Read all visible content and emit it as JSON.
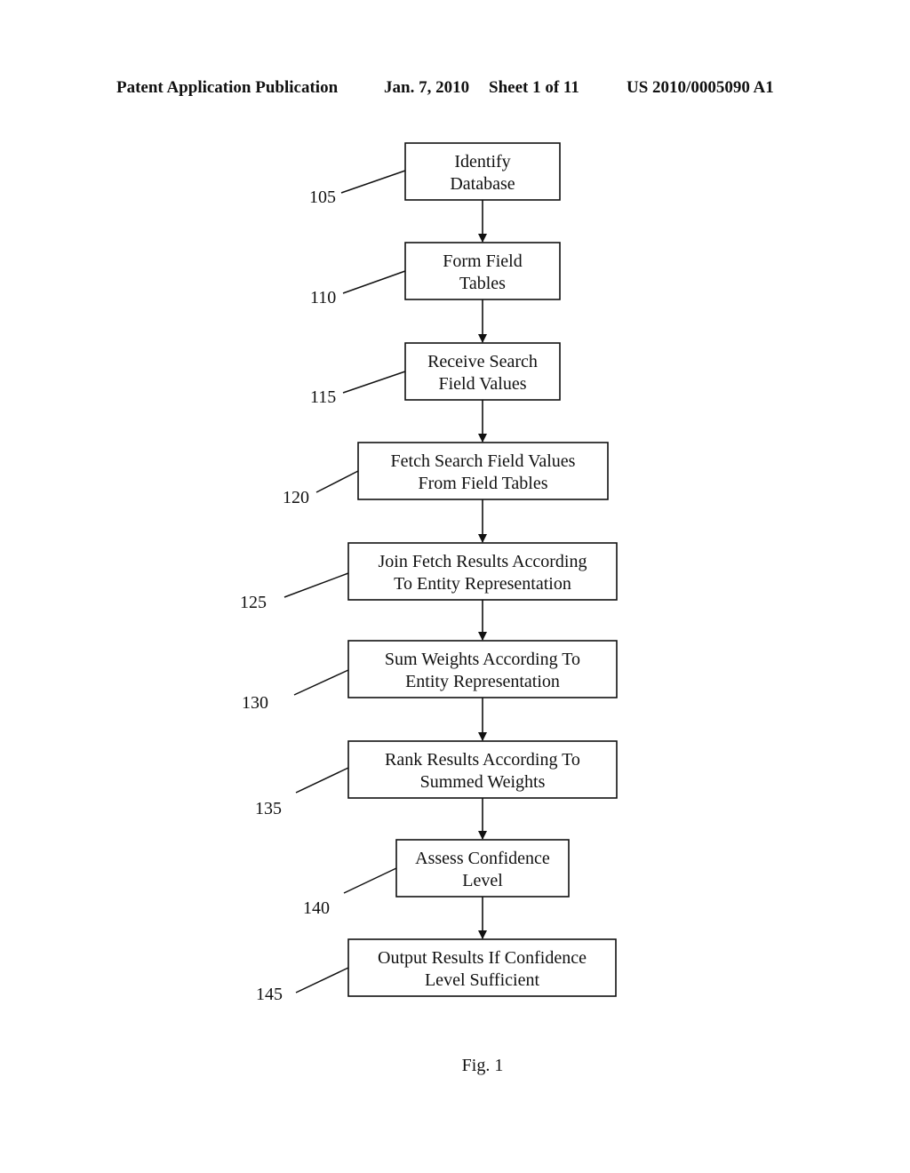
{
  "header": {
    "left": "Patent Application Publication",
    "date": "Jan. 7, 2010",
    "sheet": "Sheet 1 of 11",
    "number": "US 2010/0005090 A1"
  },
  "flowchart": {
    "steps": [
      {
        "ref": "105",
        "lines": [
          "Identify",
          "Database"
        ]
      },
      {
        "ref": "110",
        "lines": [
          "Form Field",
          "Tables"
        ]
      },
      {
        "ref": "115",
        "lines": [
          "Receive Search",
          "Field Values"
        ]
      },
      {
        "ref": "120",
        "lines": [
          "Fetch Search Field Values",
          "From Field Tables"
        ]
      },
      {
        "ref": "125",
        "lines": [
          "Join Fetch Results According",
          "To Entity Representation"
        ]
      },
      {
        "ref": "130",
        "lines": [
          "Sum Weights According To",
          "Entity Representation"
        ]
      },
      {
        "ref": "135",
        "lines": [
          "Rank Results According To",
          "Summed Weights"
        ]
      },
      {
        "ref": "140",
        "lines": [
          "Assess Confidence",
          "Level"
        ]
      },
      {
        "ref": "145",
        "lines": [
          "Output Results If Confidence",
          "Level Sufficient"
        ]
      }
    ],
    "connections": [
      {
        "from": "105",
        "to": "110"
      },
      {
        "from": "110",
        "to": "115"
      },
      {
        "from": "115",
        "to": "120"
      },
      {
        "from": "120",
        "to": "125"
      },
      {
        "from": "125",
        "to": "130"
      },
      {
        "from": "130",
        "to": "135"
      },
      {
        "from": "135",
        "to": "140"
      },
      {
        "from": "140",
        "to": "145"
      }
    ]
  },
  "figure_label": "Fig. 1"
}
